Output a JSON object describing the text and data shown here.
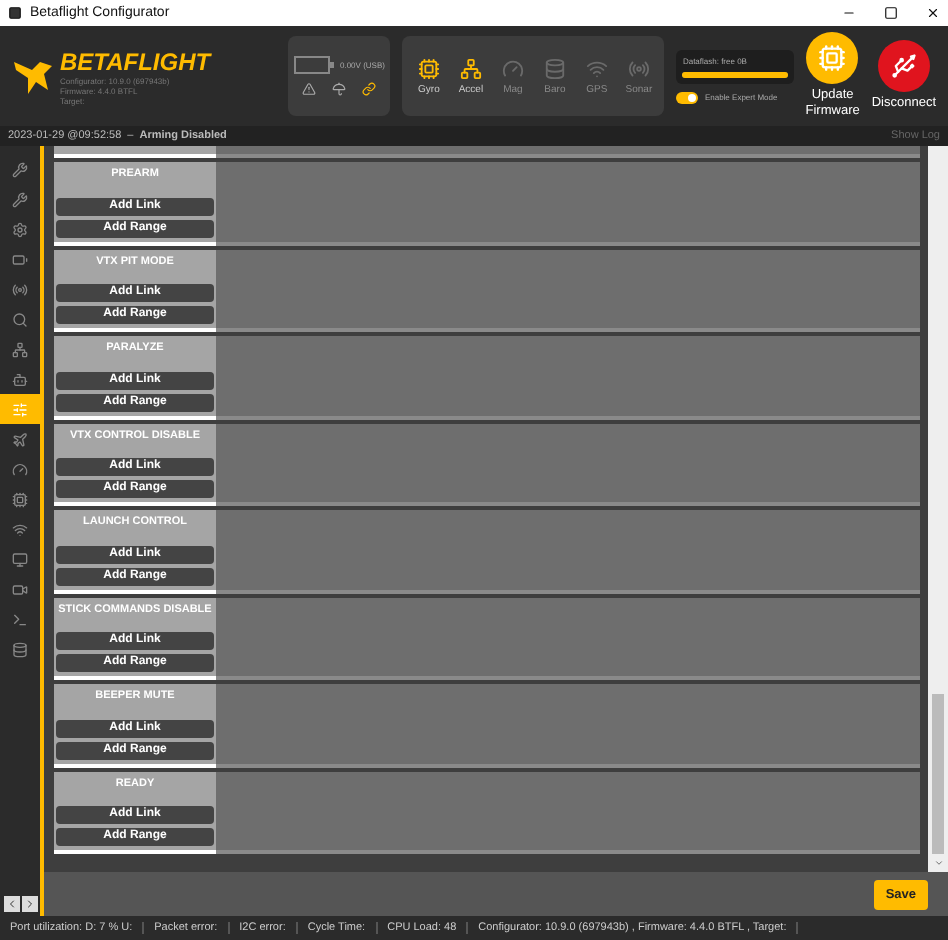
{
  "window": {
    "title": "Betaflight Configurator"
  },
  "header": {
    "logo": "BETAFLIGHT",
    "info": [
      "Configurator: 10.9.0 (697943b)",
      "Firmware: 4.4.0 BTFL",
      "Target:"
    ],
    "battery": "0.00V (USB)",
    "sensors": [
      {
        "label": "Gyro",
        "active": true
      },
      {
        "label": "Accel",
        "active": true
      },
      {
        "label": "Mag",
        "active": false
      },
      {
        "label": "Baro",
        "active": false
      },
      {
        "label": "GPS",
        "active": false
      },
      {
        "label": "Sonar",
        "active": false
      }
    ],
    "dataflash": {
      "label": "Dataflash: free 0B",
      "level": 1
    },
    "expert_mode": {
      "label": "Enable Expert Mode",
      "on": true
    },
    "buttons": [
      {
        "kind": "update",
        "label": "Update Firmware"
      },
      {
        "kind": "disconnect",
        "label": "Disconnect"
      }
    ]
  },
  "status": {
    "time": "2023-01-29 @09:52:58",
    "separator": "–",
    "state": "Arming Disabled",
    "show_log": "Show Log"
  },
  "sidebar": {
    "items": [
      {
        "selected": false
      },
      {
        "selected": false
      },
      {
        "selected": false
      },
      {
        "selected": false
      },
      {
        "selected": false
      },
      {
        "selected": false
      },
      {
        "selected": false
      },
      {
        "selected": false
      },
      {
        "selected": true
      },
      {
        "selected": false
      },
      {
        "selected": false
      },
      {
        "selected": false
      },
      {
        "selected": false
      },
      {
        "selected": false
      },
      {
        "selected": false
      },
      {
        "selected": false
      },
      {
        "selected": false
      }
    ]
  },
  "modes": [
    {
      "name": "PREARM",
      "link": "Add Link",
      "range": "Add Range"
    },
    {
      "name": "VTX PIT MODE",
      "link": "Add Link",
      "range": "Add Range"
    },
    {
      "name": "PARALYZE",
      "link": "Add Link",
      "range": "Add Range"
    },
    {
      "name": "VTX CONTROL DISABLE",
      "link": "Add Link",
      "range": "Add Range"
    },
    {
      "name": "LAUNCH CONTROL",
      "link": "Add Link",
      "range": "Add Range"
    },
    {
      "name": "STICK COMMANDS DISABLE",
      "link": "Add Link",
      "range": "Add Range"
    },
    {
      "name": "BEEPER MUTE",
      "link": "Add Link",
      "range": "Add Range"
    },
    {
      "name": "READY",
      "link": "Add Link",
      "range": "Add Range"
    }
  ],
  "save": "Save",
  "status_bar": [
    "Port utilization: D: 7 % U:",
    "Packet error:",
    "I2C error:",
    "Cycle Time:",
    "CPU Load: 48",
    "Configurator: 10.9.0 (697943b) , Firmware: 4.4.0 BTFL , Target:"
  ]
}
